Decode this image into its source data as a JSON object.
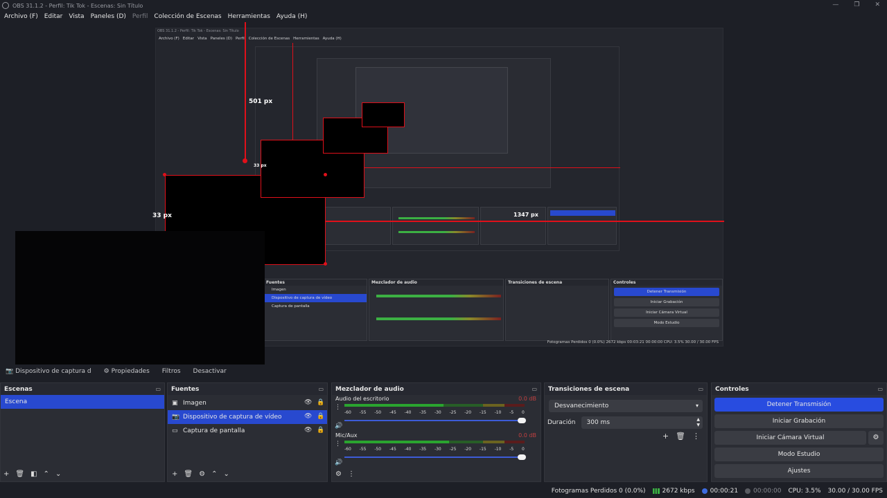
{
  "window": {
    "title": "OBS 31.1.2 - Perfil: Tik Tok - Escenas: Sin Título",
    "controls": [
      "—",
      "❐",
      "✕"
    ]
  },
  "menu": [
    "Archivo (F)",
    "Editar",
    "Vista",
    "Paneles (D)",
    "Perfil",
    "Colección de Escenas",
    "Herramientas",
    "Ayuda (H)"
  ],
  "preview": {
    "measure_top": "501 px",
    "measure_left": "33 px",
    "nested_measure_small": "33 px",
    "nested_measure_right": "1347 px",
    "nested_menu": [
      "Archivo (F)",
      "Editar",
      "Vista",
      "Paneles (D)",
      "Perfil",
      "Colección de Escenas",
      "Herramientas",
      "Ayuda (H)"
    ],
    "nested_title": "OBS 31.1.2 - Perfil: Tik Tok - Escenas: Sin Título",
    "nested_status": "Fotogramas Perdidos 0 (0.0%)   2672 kbps   00:03:21   00:00:00   CPU: 3.5%   30.00 / 30.00 FPS"
  },
  "source_toolbar": {
    "source_name": "Dispositivo de captura d",
    "properties": "Propiedades",
    "filters": "Filtros",
    "deactivate": "Desactivar"
  },
  "docks": {
    "scenes": {
      "title": "Escenas",
      "items": [
        "Escena"
      ]
    },
    "sources": {
      "title": "Fuentes",
      "items": [
        {
          "name": "Imagen",
          "icon": "image-icon"
        },
        {
          "name": "Dispositivo de captura de vídeo",
          "icon": "camera-icon"
        },
        {
          "name": "Captura de pantalla",
          "icon": "monitor-icon"
        }
      ]
    },
    "mixer": {
      "title": "Mezclador de audio",
      "channels": [
        {
          "name": "Audio del escritorio",
          "db": "0.0 dB",
          "level": 0.62
        },
        {
          "name": "Mic/Aux",
          "db": "0.0 dB",
          "level": 0.58
        }
      ],
      "ticks": [
        "-60",
        "-55",
        "-50",
        "-45",
        "-40",
        "-35",
        "-30",
        "-25",
        "-20",
        "-15",
        "-10",
        "-5",
        "0"
      ]
    },
    "transitions": {
      "title": "Transiciones de escena",
      "selected": "Desvanecimiento",
      "duration_label": "Duración",
      "duration_value": "300 ms"
    },
    "controls": {
      "title": "Controles",
      "buttons": [
        "Detener Transmisión",
        "Iniciar Grabación",
        "Iniciar Cámara Virtual",
        "Modo Estudio",
        "Ajustes"
      ]
    }
  },
  "status": {
    "dropped": "Fotogramas Perdidos 0 (0.0%)",
    "bitrate": "2672 kbps",
    "stream_time": "00:00:21",
    "rec_time": "00:00:00",
    "cpu": "CPU: 3.5%",
    "fps": "30.00 / 30.00 FPS"
  },
  "colors": {
    "accent": "#284ce0",
    "measure": "#e0101a",
    "background": "#1d1f26",
    "dock": "#2b2d34"
  }
}
